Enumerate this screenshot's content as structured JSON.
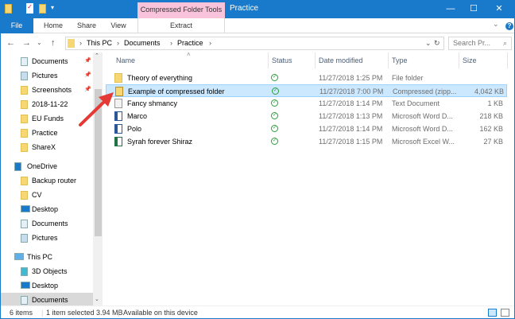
{
  "window": {
    "title": "Practice",
    "context_tab": "Compressed Folder Tools",
    "minimize": "—",
    "maximize": "☐",
    "close": "✕"
  },
  "ribbon": {
    "tabs": [
      "File",
      "Home",
      "Share",
      "View"
    ],
    "context_subtab": "Extract",
    "help": "?",
    "collapse": "⌄"
  },
  "nav": {
    "back": "←",
    "forward": "→",
    "recent": "⌄",
    "up": "↑",
    "breadcrumb": [
      "This PC",
      "Documents",
      "Practice"
    ],
    "refresh": "↻",
    "dropdown": "⌄",
    "search_placeholder": "Search Pr...",
    "search_icon": "⌕"
  },
  "sidebar": {
    "items": [
      {
        "label": "Documents",
        "icon": "documents-icon",
        "pinned": true
      },
      {
        "label": "Pictures",
        "icon": "pictures-icon",
        "pinned": true
      },
      {
        "label": "Screenshots",
        "icon": "folder-icon",
        "pinned": true
      },
      {
        "label": "2018-11-22",
        "icon": "folder-icon"
      },
      {
        "label": "EU Funds",
        "icon": "folder-icon"
      },
      {
        "label": "Practice",
        "icon": "folder-icon"
      },
      {
        "label": "ShareX",
        "icon": "folder-icon"
      },
      {
        "label": "OneDrive",
        "icon": "onedrive-icon",
        "root": true
      },
      {
        "label": "Backup router",
        "icon": "folder-icon"
      },
      {
        "label": "CV",
        "icon": "folder-icon"
      },
      {
        "label": "Desktop",
        "icon": "desktop-icon"
      },
      {
        "label": "Documents",
        "icon": "documents-icon"
      },
      {
        "label": "Pictures",
        "icon": "pictures-icon"
      },
      {
        "label": "This PC",
        "icon": "pc-icon",
        "root": true
      },
      {
        "label": "3D Objects",
        "icon": "3d-objects-icon"
      },
      {
        "label": "Desktop",
        "icon": "desktop-icon"
      },
      {
        "label": "Documents",
        "icon": "documents-icon",
        "selected": true
      }
    ],
    "pin_glyph": "📌"
  },
  "columns": {
    "name": "Name",
    "status": "Status",
    "date": "Date modified",
    "type": "Type",
    "size": "Size"
  },
  "files": [
    {
      "name": "Theory of everything",
      "kind": "folder",
      "date": "11/27/2018 1:25 PM",
      "type": "File folder",
      "size": ""
    },
    {
      "name": "Example of compressed folder",
      "kind": "zip",
      "date": "11/27/2018 7:00 PM",
      "type": "Compressed (zipp...",
      "size": "4,042 KB",
      "selected": true
    },
    {
      "name": "Fancy shmancy",
      "kind": "text",
      "date": "11/27/2018 1:14 PM",
      "type": "Text Document",
      "size": "1 KB"
    },
    {
      "name": "Marco",
      "kind": "word",
      "date": "11/27/2018 1:13 PM",
      "type": "Microsoft Word D...",
      "size": "218 KB"
    },
    {
      "name": "Polo",
      "kind": "word",
      "date": "11/27/2018 1:14 PM",
      "type": "Microsoft Word D...",
      "size": "162 KB"
    },
    {
      "name": "Syrah forever Shiraz",
      "kind": "excel",
      "date": "11/27/2018 1:15 PM",
      "type": "Microsoft Excel W...",
      "size": "27 KB"
    }
  ],
  "status_bar": {
    "items": "6 items",
    "selected": "1 item selected  3.94 MB",
    "availability": "Available on this device"
  },
  "colors": {
    "accent": "#1979ca",
    "context_tab": "#f9c3dc",
    "selection": "#cce8ff",
    "annotation_arrow": "#e53935"
  }
}
